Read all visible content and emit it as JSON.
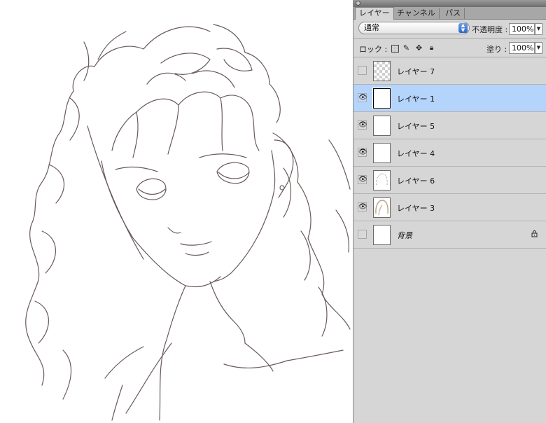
{
  "tabs": [
    {
      "label": "レイヤー",
      "active": true
    },
    {
      "label": "チャンネル",
      "active": false
    },
    {
      "label": "パス",
      "active": false
    }
  ],
  "blend": {
    "mode": "通常",
    "opacity_label": "不透明度 :",
    "opacity_value": "100%"
  },
  "lock": {
    "label": "ロック :",
    "icons": [
      "transparent-lock-icon",
      "brush-lock-icon",
      "move-lock-icon",
      "all-lock-icon"
    ]
  },
  "fill": {
    "label": "塗り :",
    "value": "100%"
  },
  "layers": [
    {
      "name": "レイヤー 7",
      "visible": false,
      "selected": false,
      "thumb": "checker"
    },
    {
      "name": "レイヤー 1",
      "visible": true,
      "selected": true,
      "thumb": "white"
    },
    {
      "name": "レイヤー 5",
      "visible": true,
      "selected": false,
      "thumb": "white"
    },
    {
      "name": "レイヤー 4",
      "visible": true,
      "selected": false,
      "thumb": "white"
    },
    {
      "name": "レイヤー 6",
      "visible": true,
      "selected": false,
      "thumb": "sketch"
    },
    {
      "name": "レイヤー 3",
      "visible": true,
      "selected": false,
      "thumb": "hair"
    },
    {
      "name": "背景",
      "visible": false,
      "selected": false,
      "thumb": "white",
      "locked": true
    }
  ],
  "colors": {
    "panel_bg": "#d6d6d6",
    "selected_row": "#b5d4fc",
    "line_art": "#6a5a5a"
  }
}
